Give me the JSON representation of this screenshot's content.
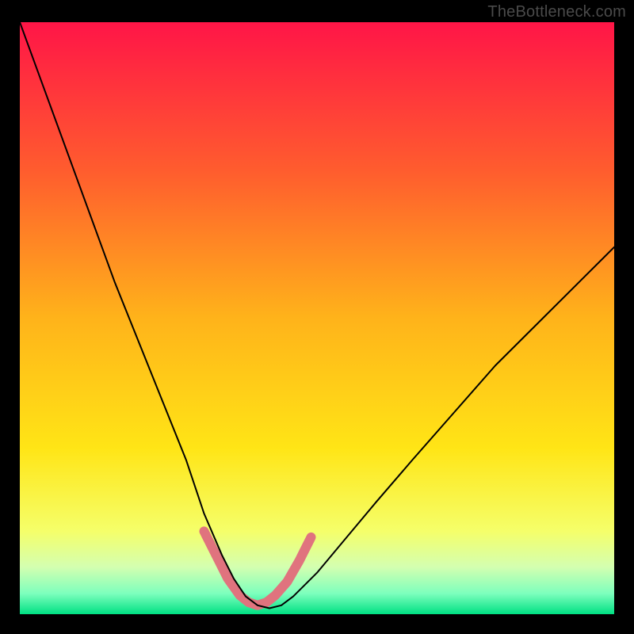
{
  "watermark": "TheBottleneck.com",
  "chart_data": {
    "type": "line",
    "title": "",
    "xlabel": "",
    "ylabel": "",
    "xlim": [
      0,
      100
    ],
    "ylim": [
      0,
      100
    ],
    "grid": false,
    "legend": false,
    "background": {
      "gradient_stops": [
        {
          "offset": 0.0,
          "color": "#ff1547"
        },
        {
          "offset": 0.25,
          "color": "#ff5c2e"
        },
        {
          "offset": 0.5,
          "color": "#ffb31a"
        },
        {
          "offset": 0.72,
          "color": "#ffe516"
        },
        {
          "offset": 0.86,
          "color": "#f5ff6a"
        },
        {
          "offset": 0.92,
          "color": "#d4ffb0"
        },
        {
          "offset": 0.965,
          "color": "#7dffbd"
        },
        {
          "offset": 1.0,
          "color": "#00e083"
        }
      ],
      "direction": "top-to-bottom"
    },
    "series": [
      {
        "name": "bottleneck-curve",
        "type": "line",
        "stroke": "#000000",
        "stroke_width": 2,
        "x": [
          0,
          4,
          8,
          12,
          16,
          20,
          24,
          28,
          31,
          34,
          36,
          38,
          40,
          42,
          44,
          46,
          50,
          55,
          60,
          66,
          73,
          80,
          88,
          95,
          100
        ],
        "y": [
          100,
          89,
          78,
          67,
          56,
          46,
          36,
          26,
          17,
          10,
          6,
          3,
          1.5,
          1,
          1.5,
          3,
          7,
          13,
          19,
          26,
          34,
          42,
          50,
          57,
          62
        ]
      },
      {
        "name": "trough-highlight",
        "type": "line",
        "stroke": "#e0737e",
        "stroke_width": 12,
        "linecap": "round",
        "x": [
          31,
          33,
          35,
          37,
          38.5,
          40,
          41.5,
          43,
          45,
          47,
          49
        ],
        "y": [
          14,
          10,
          6,
          3.2,
          2,
          1.5,
          2,
          3.2,
          5.5,
          9,
          13
        ]
      }
    ]
  }
}
